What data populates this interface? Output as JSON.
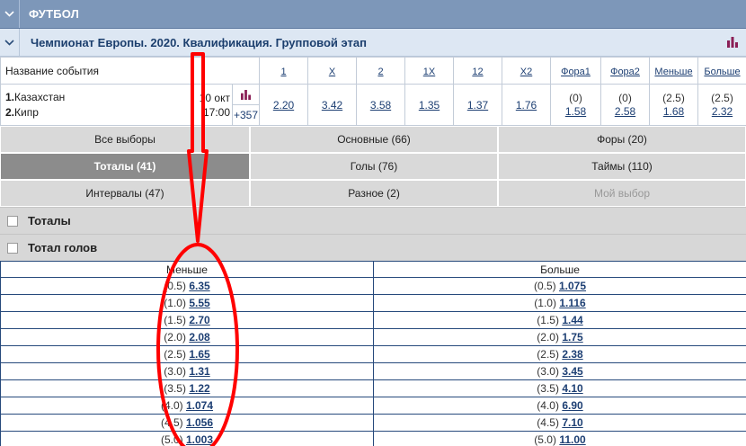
{
  "sport": {
    "title": "ФУТБОЛ",
    "chevron_icon": "chevron-down-icon"
  },
  "league": {
    "title": "Чемпионат Европы. 2020. Квалификация. Групповой этап",
    "stats_icon": "bar-chart-icon",
    "stats_color": "#8a1f56"
  },
  "odds_header": {
    "name": "Название события",
    "cols": [
      "1",
      "X",
      "2",
      "1X",
      "12",
      "X2",
      "Фора1",
      "Фора2",
      "Меньше",
      "Больше"
    ]
  },
  "event": {
    "team1_num": "1.",
    "team1": "Казахстан",
    "team2_num": "2.",
    "team2": "Кипр",
    "date": "10 окт",
    "time": "17:00",
    "more": "+357",
    "odds": [
      "2.20",
      "3.42",
      "3.58",
      "1.35",
      "1.37",
      "1.76"
    ],
    "fora1": {
      "hcp": "(0)",
      "odd": "1.58"
    },
    "fora2": {
      "hcp": "(0)",
      "odd": "2.58"
    },
    "under": {
      "hcp": "(2.5)",
      "odd": "1.68"
    },
    "over": {
      "hcp": "(2.5)",
      "odd": "2.32"
    }
  },
  "tabs": [
    [
      {
        "label": "Все выборы",
        "state": "normal"
      },
      {
        "label": "Основные (66)",
        "state": "normal"
      },
      {
        "label": "Форы (20)",
        "state": "normal"
      }
    ],
    [
      {
        "label": "Тоталы (41)",
        "state": "active"
      },
      {
        "label": "Голы (76)",
        "state": "normal"
      },
      {
        "label": "Таймы (110)",
        "state": "normal"
      }
    ],
    [
      {
        "label": "Интервалы (47)",
        "state": "normal"
      },
      {
        "label": "Разное (2)",
        "state": "normal"
      },
      {
        "label": "Мой выбор",
        "state": "disabled"
      }
    ]
  ],
  "sections": {
    "totals": "Тоталы",
    "total_goals": "Тотал голов"
  },
  "totals_table": {
    "under_label": "Меньше",
    "over_label": "Больше",
    "rows": [
      {
        "line": "(0.5)",
        "under": "6.35",
        "over": "1.075"
      },
      {
        "line": "(1.0)",
        "under": "5.55",
        "over": "1.116"
      },
      {
        "line": "(1.5)",
        "under": "2.70",
        "over": "1.44"
      },
      {
        "line": "(2.0)",
        "under": "2.08",
        "over": "1.75"
      },
      {
        "line": "(2.5)",
        "under": "1.65",
        "over": "2.38"
      },
      {
        "line": "(3.0)",
        "under": "1.31",
        "over": "3.45"
      },
      {
        "line": "(3.5)",
        "under": "1.22",
        "over": "4.10"
      },
      {
        "line": "(4.0)",
        "under": "1.074",
        "over": "6.90"
      },
      {
        "line": "(4.5)",
        "under": "1.056",
        "over": "7.10"
      },
      {
        "line": "(5.0)",
        "under": "1.003",
        "over": "11.00"
      }
    ]
  },
  "annotation": {
    "shape": "red-arrow-and-ellipse",
    "color": "#ff0000"
  }
}
